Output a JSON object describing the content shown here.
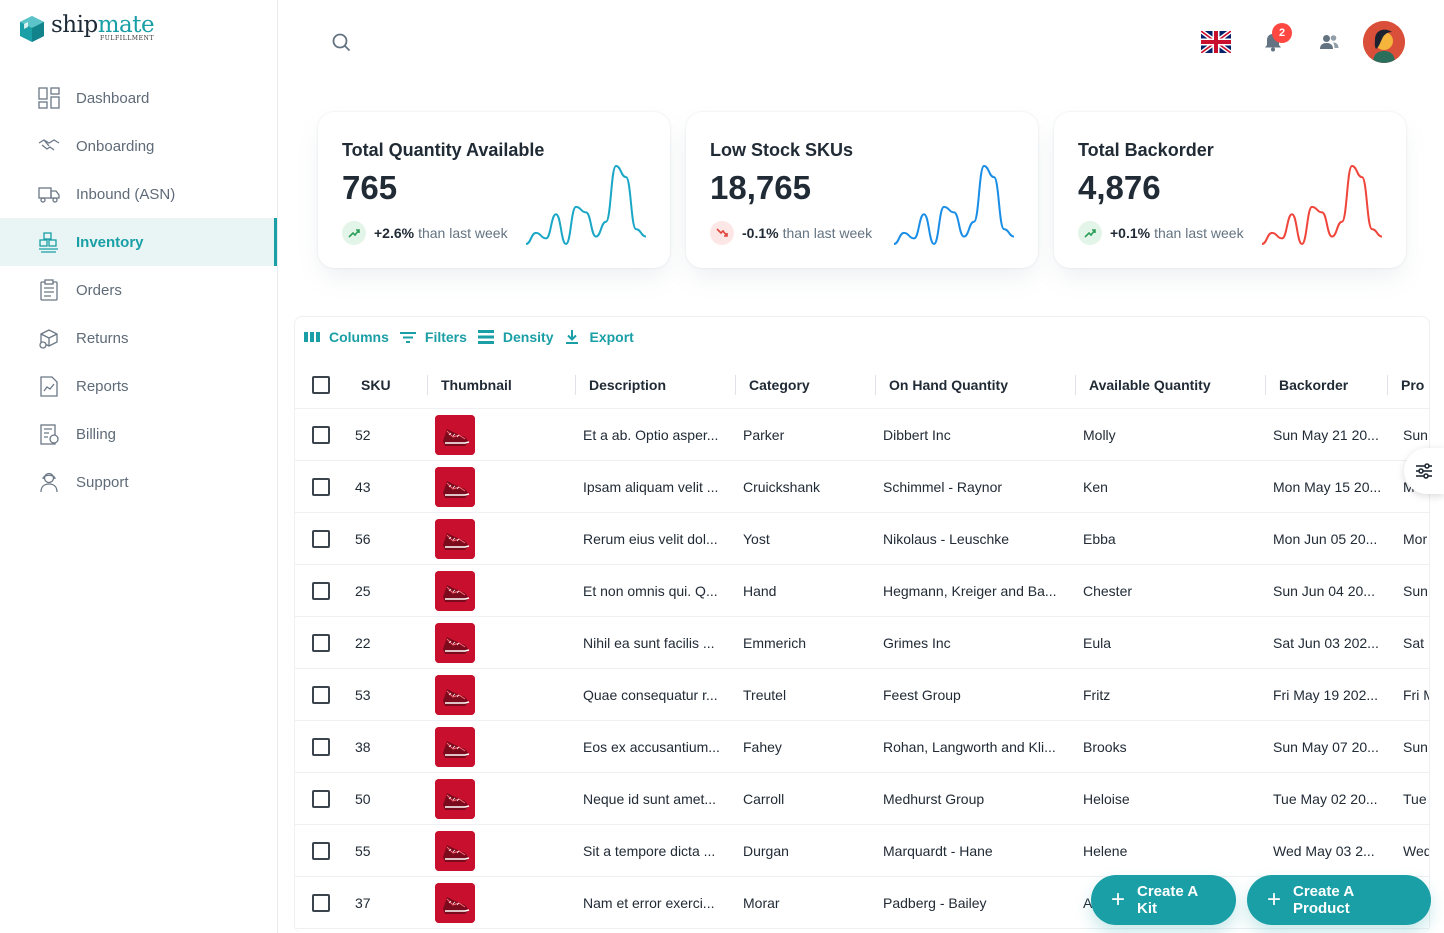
{
  "brand": {
    "name_part1": "ship",
    "name_part2": "mate",
    "tagline": "FULFILLMENT"
  },
  "sidebar": {
    "items": [
      {
        "label": "Dashboard",
        "icon": "dashboard-icon"
      },
      {
        "label": "Onboarding",
        "icon": "handshake-icon"
      },
      {
        "label": "Inbound (ASN)",
        "icon": "truck-icon"
      },
      {
        "label": "Inventory",
        "icon": "inventory-icon",
        "active": true
      },
      {
        "label": "Orders",
        "icon": "clipboard-icon"
      },
      {
        "label": "Returns",
        "icon": "returns-icon"
      },
      {
        "label": "Reports",
        "icon": "report-icon"
      },
      {
        "label": "Billing",
        "icon": "billing-icon"
      },
      {
        "label": "Support",
        "icon": "support-icon"
      }
    ]
  },
  "header": {
    "notifications_count": "2"
  },
  "cards": [
    {
      "title": "Total Quantity Available",
      "value": "765",
      "change": "+2.6%",
      "suffix": "than last week",
      "direction": "up",
      "color": "#1aa7c6",
      "spark": [
        2,
        8,
        5,
        18,
        2,
        22,
        19,
        6,
        14,
        44,
        38,
        10,
        6
      ]
    },
    {
      "title": "Low Stock SKUs",
      "value": "18,765",
      "change": "-0.1%",
      "suffix": "than last week",
      "direction": "down",
      "color": "#1a8ee6",
      "spark": [
        2,
        8,
        5,
        18,
        2,
        22,
        19,
        6,
        14,
        44,
        38,
        10,
        6
      ]
    },
    {
      "title": "Total Backorder",
      "value": "4,876",
      "change": "+0.1%",
      "suffix": "than last week",
      "direction": "up",
      "color": "#f0453a",
      "spark": [
        2,
        8,
        5,
        18,
        2,
        22,
        19,
        6,
        14,
        44,
        38,
        10,
        6
      ]
    }
  ],
  "toolbar": {
    "columns": "Columns",
    "filters": "Filters",
    "density": "Density",
    "export": "Export"
  },
  "table": {
    "headers": [
      "SKU",
      "Thumbnail",
      "Description",
      "Category",
      "On Hand Quantity",
      "Available Quantity",
      "Backorder",
      "Pro"
    ],
    "rows": [
      [
        "52",
        "Et a ab. Optio asper...",
        "Parker",
        "Dibbert Inc",
        "Molly",
        "Sun May 21 20...",
        "Sun"
      ],
      [
        "43",
        "Ipsam aliquam velit ...",
        "Cruickshank",
        "Schimmel - Raynor",
        "Ken",
        "Mon May 15 20...",
        "M"
      ],
      [
        "56",
        "Rerum eius velit dol...",
        "Yost",
        "Nikolaus - Leuschke",
        "Ebba",
        "Mon Jun 05 20...",
        "Mor"
      ],
      [
        "25",
        "Et non omnis qui. Q...",
        "Hand",
        "Hegmann, Kreiger and Ba...",
        "Chester",
        "Sun Jun 04 20...",
        "Sun"
      ],
      [
        "22",
        "Nihil ea sunt facilis ...",
        "Emmerich",
        "Grimes Inc",
        "Eula",
        "Sat Jun 03 202...",
        "Sat"
      ],
      [
        "53",
        "Quae consequatur r...",
        "Treutel",
        "Feest Group",
        "Fritz",
        "Fri May 19 202...",
        "Fri M"
      ],
      [
        "38",
        "Eos ex accusantium...",
        "Fahey",
        "Rohan, Langworth and Kli...",
        "Brooks",
        "Sun May 07 20...",
        "Sun"
      ],
      [
        "50",
        "Neque id sunt amet...",
        "Carroll",
        "Medhurst Group",
        "Heloise",
        "Tue May 02 20...",
        "Tue"
      ],
      [
        "55",
        "Sit a tempore dicta ...",
        "Durgan",
        "Marquardt - Hane",
        "Helene",
        "Wed May 03 2...",
        "Wed"
      ],
      [
        "37",
        "Nam et error exerci...",
        "Morar",
        "Padberg - Bailey",
        "A",
        "",
        ""
      ]
    ]
  },
  "fabs": {
    "create_kit": "Create A Kit",
    "create_product": "Create A Product"
  }
}
